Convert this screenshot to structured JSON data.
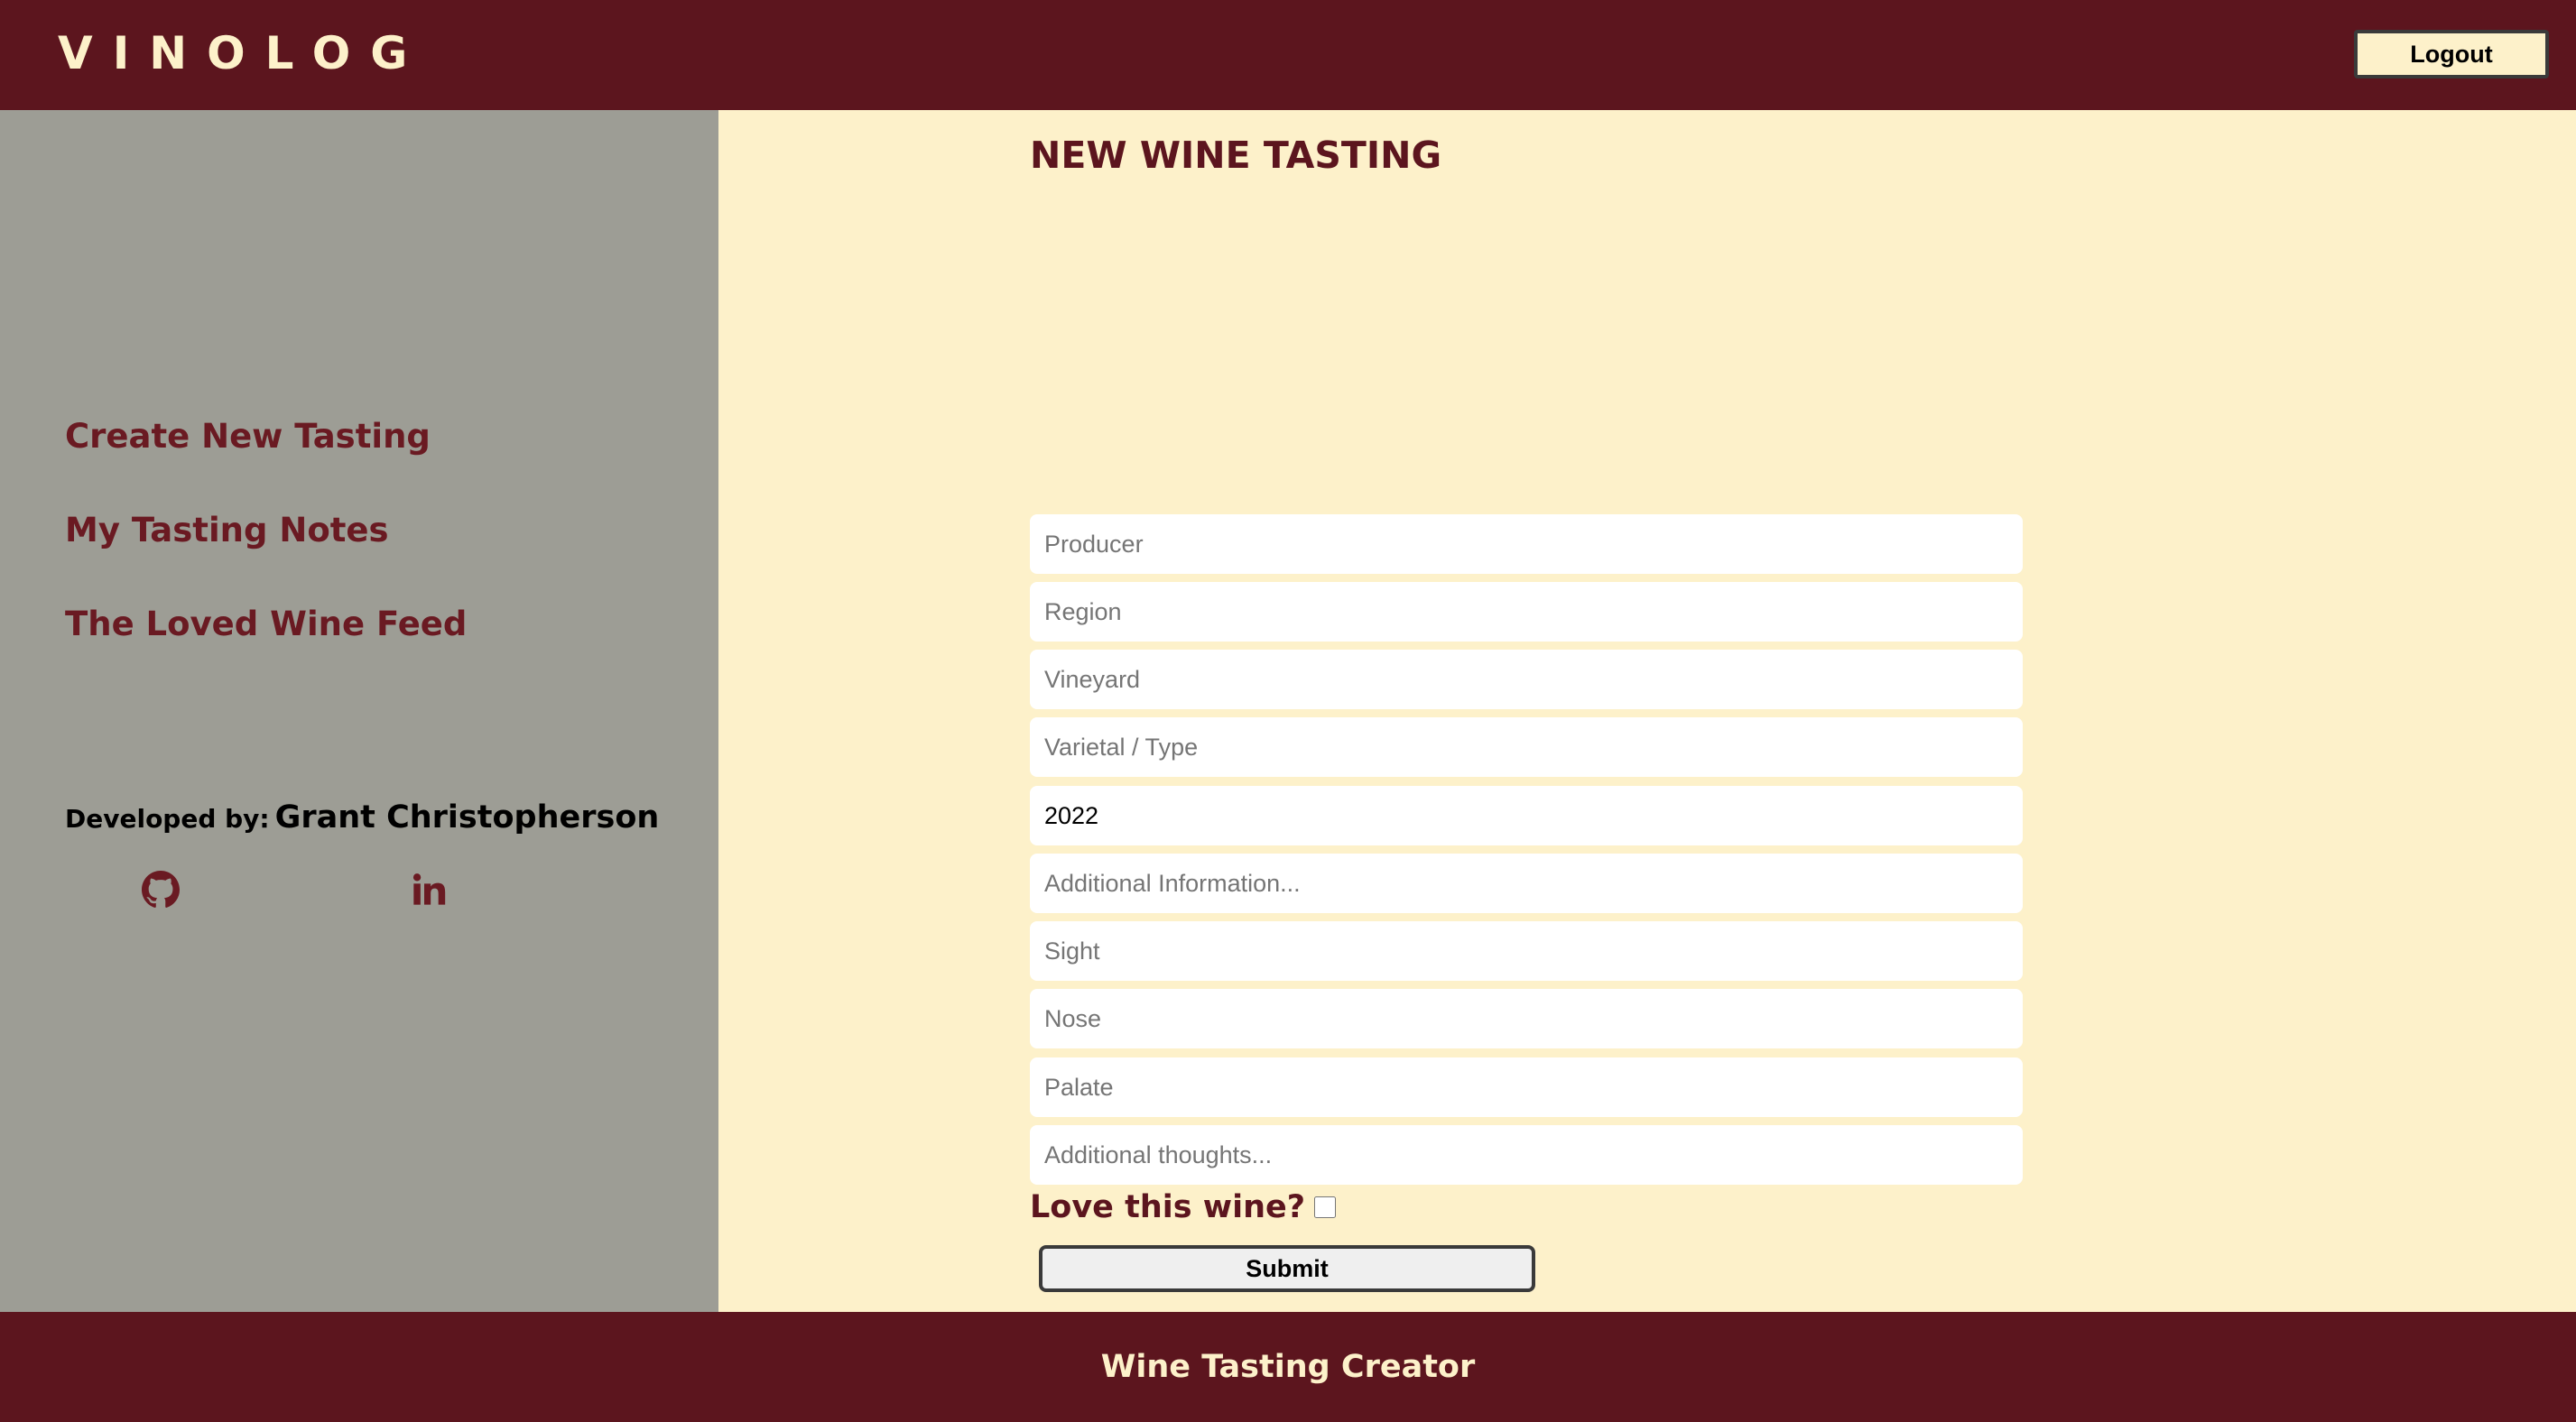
{
  "header": {
    "brand": "VINOLOG",
    "logout_label": "Logout"
  },
  "sidebar": {
    "items": [
      {
        "label": "Create New Tasting"
      },
      {
        "label": "My Tasting Notes"
      },
      {
        "label": "The Loved Wine Feed"
      }
    ],
    "developed_by_label": "Developed by:",
    "developer_name": "Grant Christopherson",
    "social_icons": [
      "github-icon",
      "linkedin-icon"
    ]
  },
  "main": {
    "title": "NEW WINE TASTING",
    "fields": {
      "producer": {
        "placeholder": "Producer",
        "value": ""
      },
      "region": {
        "placeholder": "Region",
        "value": ""
      },
      "vineyard": {
        "placeholder": "Vineyard",
        "value": ""
      },
      "varietal": {
        "placeholder": "Varietal / Type",
        "value": ""
      },
      "vintage": {
        "placeholder": "",
        "value": "2022"
      },
      "additional_info": {
        "placeholder": "Additional Information...",
        "value": ""
      },
      "sight": {
        "placeholder": "Sight",
        "value": ""
      },
      "nose": {
        "placeholder": "Nose",
        "value": ""
      },
      "palate": {
        "placeholder": "Palate",
        "value": ""
      },
      "additional_thoughts": {
        "placeholder": "Additional thoughts...",
        "value": ""
      }
    },
    "love_label": "Love this wine?",
    "love_checked": false,
    "submit_label": "Submit"
  },
  "footer": {
    "text": "Wine Tasting Creator"
  },
  "colors": {
    "brand": "#5c151e",
    "cream": "#fdf1ca",
    "sidebar": "#9d9d95",
    "link": "#6a1a22"
  }
}
